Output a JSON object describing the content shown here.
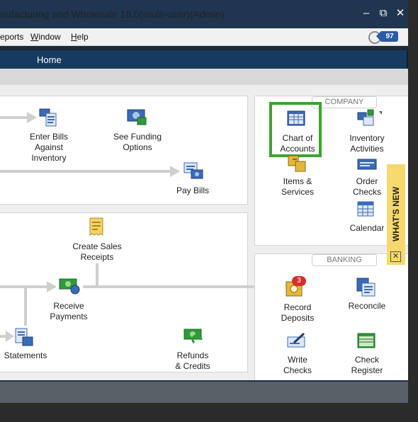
{
  "window": {
    "title": "nufacturing and Wholesale 18.0(multi-user)(Admin)",
    "minimize": "–",
    "restore": "⧉",
    "close": "✕"
  },
  "menu": {
    "items": [
      {
        "label": "eports",
        "underline": ""
      },
      {
        "label": "indow",
        "underline": "W"
      },
      {
        "label": "elp",
        "underline": "H"
      }
    ],
    "reminder_count": "97"
  },
  "nav": {
    "home_tab": "Home"
  },
  "vendors": {
    "enter_bills": "Enter Bills\nAgainst\nInventory",
    "see_funding": "See Funding\nOptions",
    "pay_bills": "Pay Bills"
  },
  "customers": {
    "create_sales_receipts": "Create Sales\nReceipts",
    "receive_payments": "Receive\nPayments",
    "statements": "Statements",
    "refunds_credits": "Refunds\n& Credits"
  },
  "company": {
    "section_label": "COMPANY",
    "chart_of_accounts": "Chart of\nAccounts",
    "inventory_activities": "Inventory\nActivities",
    "items_services": "Items &\nServices",
    "order_checks": "Order\nChecks",
    "calendar": "Calendar"
  },
  "banking": {
    "section_label": "BANKING",
    "record_deposits": "Record\nDeposits",
    "deposits_badge": "3",
    "reconcile": "Reconcile",
    "write_checks": "Write\nChecks",
    "check_register": "Check\nRegister"
  },
  "whats_new": {
    "label": "WHAT'S NEW",
    "close": "✕"
  },
  "colors": {
    "title_bar": "#1f3550",
    "home_bar": "#173a60",
    "highlight": "#3aa52b",
    "badge": "#2c5aa8",
    "whats_new": "#f5d96c"
  }
}
